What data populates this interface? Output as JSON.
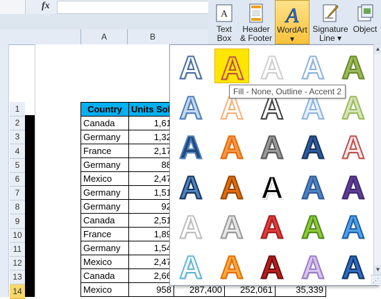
{
  "formula_bar": {
    "fx_label": "fx",
    "value": ""
  },
  "columns": [
    "A",
    "B"
  ],
  "rows": [
    "1",
    "2",
    "3",
    "4",
    "5",
    "6",
    "7",
    "8",
    "9",
    "10",
    "11",
    "12",
    "13",
    "14"
  ],
  "selected_row": "14",
  "table": {
    "headers": [
      "Country",
      "Units Sol"
    ],
    "rows": [
      [
        "Canada",
        "1,61"
      ],
      [
        "Germany",
        "1,32"
      ],
      [
        "France",
        "2,17"
      ],
      [
        "Germany",
        "88"
      ],
      [
        "Mexico",
        "2,47"
      ],
      [
        "Germany",
        "1,51"
      ],
      [
        "Germany",
        "92"
      ],
      [
        "Canada",
        "2,51"
      ],
      [
        "France",
        "1,89"
      ],
      [
        "Germany",
        "1,54"
      ],
      [
        "Mexico",
        "2,47"
      ],
      [
        "Canada",
        "2,66"
      ],
      [
        "Mexico",
        "958",
        "287,400",
        "252,061",
        "35,339"
      ]
    ]
  },
  "ribbon": {
    "text_box": "Text Box",
    "text_box_l1": "Text",
    "text_box_l2": "Box",
    "header_footer_l1": "Header",
    "header_footer_l2": "& Footer",
    "wordart": "WordArt",
    "signature_l1": "Signature",
    "signature_l2": "Line",
    "object": "Object",
    "dropdown_arrow": "▾"
  },
  "gallery": {
    "tooltip": "Fill - None, Outline - Accent 2",
    "glyph": "A",
    "styles": [
      [
        "outline-blue",
        "outline-orange-selected",
        "outline-white",
        "outline-blue-light",
        "fill-green"
      ],
      [
        "gradient-blue",
        "outline-orange-light",
        "outline-gray",
        "outline-blue-pale",
        "fill-green-pale"
      ],
      [
        "fill-blue",
        "fill-orange",
        "fill-gray",
        "fill-blue-dark",
        "outline-red"
      ],
      [
        "fill-blue-shadow",
        "fill-orange-dark",
        "fill-black",
        "fill-blue-mid",
        "fill-purple"
      ],
      [
        "outline-white-gray",
        "fill-silver",
        "fill-red",
        "fill-green-bright",
        "fill-blue-reflect"
      ],
      [
        "outline-cyan",
        "fill-orange-bright",
        "fill-red-dark",
        "fill-lavender",
        "fill-blue-deep"
      ]
    ]
  },
  "colors": {
    "table_header": "#00b0f0",
    "selected_row": "#f8d76b",
    "highlight": "#ffe600"
  }
}
